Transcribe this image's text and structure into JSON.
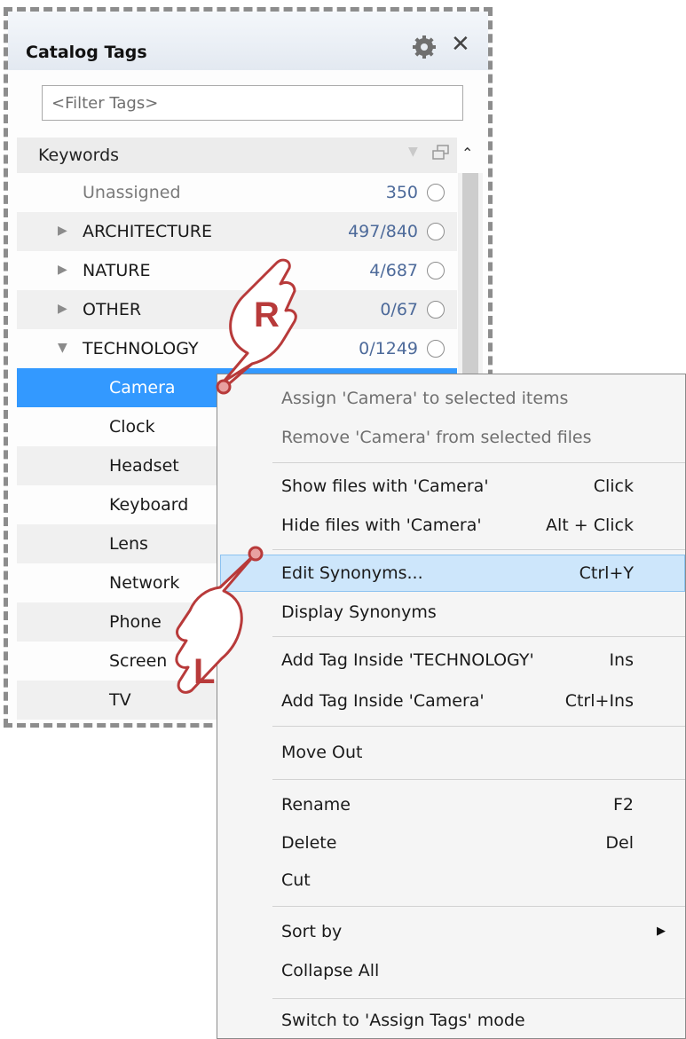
{
  "panel": {
    "title": "Catalog Tags",
    "filter_placeholder": "<Filter Tags>",
    "section_label": "Keywords",
    "rows": [
      {
        "label": "Unassigned",
        "count": "350"
      },
      {
        "label": "ARCHITECTURE",
        "count": "497/840"
      },
      {
        "label": "NATURE",
        "count": "4/687"
      },
      {
        "label": "OTHER",
        "count": "0/67"
      },
      {
        "label": "TECHNOLOGY",
        "count": "0/1249"
      },
      {
        "label": "Camera"
      },
      {
        "label": "Clock"
      },
      {
        "label": "Headset"
      },
      {
        "label": "Keyboard"
      },
      {
        "label": "Lens"
      },
      {
        "label": "Network"
      },
      {
        "label": "Phone"
      },
      {
        "label": "Screen"
      },
      {
        "label": "TV"
      }
    ]
  },
  "menu": {
    "items": [
      {
        "label": "Assign 'Camera' to selected items",
        "shortcut": ""
      },
      {
        "label": "Remove 'Camera' from selected files",
        "shortcut": ""
      },
      {
        "label": "Show files with 'Camera'",
        "shortcut": "Click"
      },
      {
        "label": "Hide files with 'Camera'",
        "shortcut": "Alt + Click"
      },
      {
        "label": "Edit Synonyms...",
        "shortcut": "Ctrl+Y"
      },
      {
        "label": "Display Synonyms",
        "shortcut": ""
      },
      {
        "label": "Add Tag Inside 'TECHNOLOGY'",
        "shortcut": "Ins"
      },
      {
        "label": "Add Tag Inside 'Camera'",
        "shortcut": "Ctrl+Ins"
      },
      {
        "label": "Move Out",
        "shortcut": ""
      },
      {
        "label": "Rename",
        "shortcut": "F2"
      },
      {
        "label": "Delete",
        "shortcut": "Del"
      },
      {
        "label": "Cut",
        "shortcut": ""
      },
      {
        "label": "Sort by",
        "shortcut": ""
      },
      {
        "label": "Collapse All",
        "shortcut": ""
      },
      {
        "label": "Switch to 'Assign Tags' mode",
        "shortcut": ""
      }
    ]
  },
  "annotations": {
    "right_click": "R",
    "left_click": "L"
  },
  "colors": {
    "selection": "#3399ff",
    "menu_highlight": "#cde6fb",
    "count_text": "#4d6a9a",
    "hand_outline": "#b83a3a"
  },
  "icons": [
    "gear-icon",
    "close-icon",
    "filter-icon",
    "window-icon",
    "chevron-up-icon",
    "expand-arrow-icon",
    "collapse-arrow-icon",
    "submenu-arrow-icon",
    "pointing-hand-icon"
  ]
}
